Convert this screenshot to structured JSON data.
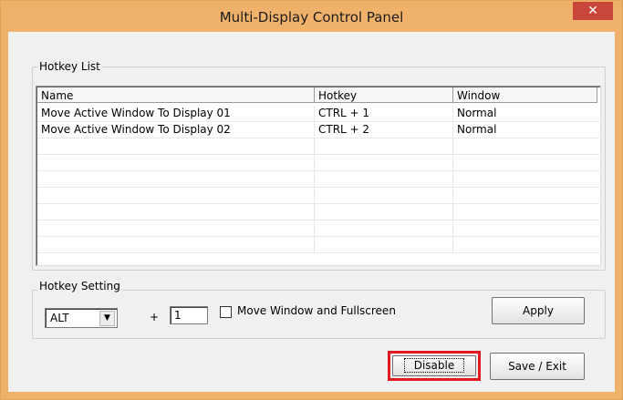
{
  "window": {
    "title": "Multi-Display Control Panel",
    "close_label": "✕"
  },
  "hotkey_list": {
    "group_label": "Hotkey List",
    "columns": [
      "Name",
      "Hotkey",
      "Window"
    ],
    "rows": [
      {
        "name": "Move Active Window To Display 01",
        "hotkey": "CTRL + 1",
        "window": "Normal"
      },
      {
        "name": "Move Active Window To Display 02",
        "hotkey": "CTRL + 2",
        "window": "Normal"
      }
    ]
  },
  "hotkey_setting": {
    "group_label": "Hotkey Setting",
    "modifier": "ALT",
    "plus": "+",
    "key_value": "1",
    "checkbox_label": "Move Window and Fullscreen",
    "checkbox_checked": false,
    "apply_label": "Apply"
  },
  "footer": {
    "disable_label": "Disable",
    "save_exit_label": "Save / Exit"
  },
  "colors": {
    "title_bar": "#f0b26a",
    "close_button": "#c9463b",
    "highlight_frame": "#e2191e"
  },
  "icons": {
    "close": "close-icon",
    "dropdown": "chevron-down-icon"
  }
}
